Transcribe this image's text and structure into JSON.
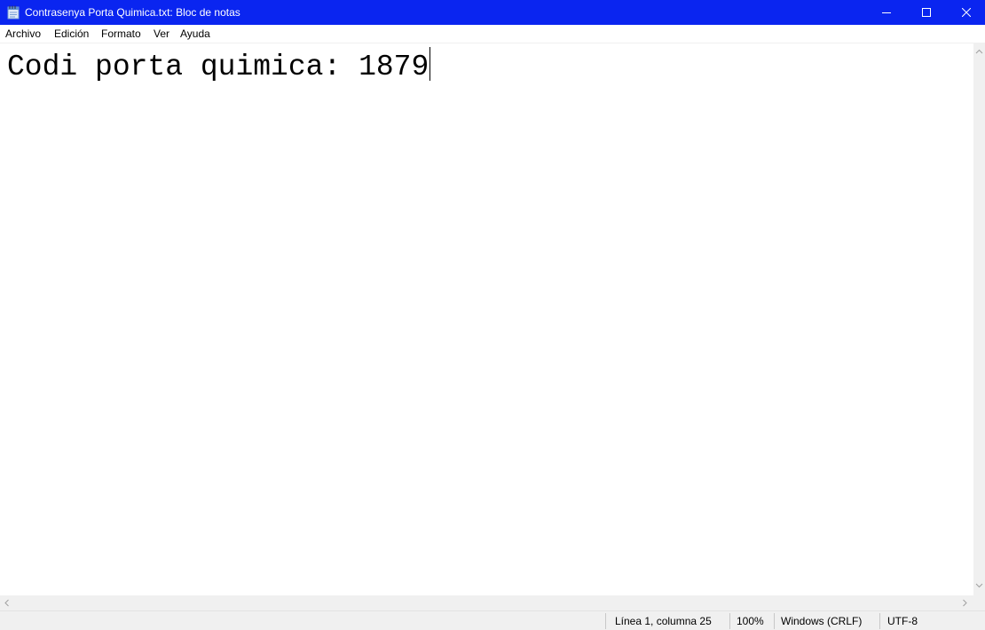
{
  "window": {
    "title": "Contrasenya Porta Quimica.txt: Bloc de notas",
    "titlebar_color": "#0a25f0",
    "icons": {
      "app": "notepad-icon",
      "minimize": "minimize-icon",
      "maximize": "maximize-icon",
      "close": "close-icon"
    }
  },
  "menu": {
    "items": [
      {
        "label": "Archivo"
      },
      {
        "label": "Edición"
      },
      {
        "label": "Formato"
      },
      {
        "label": "Ver"
      },
      {
        "label": "Ayuda"
      }
    ]
  },
  "editor": {
    "content": "Codi porta quimica: 1879"
  },
  "status": {
    "position": "Línea 1, columna 25",
    "zoom": "100%",
    "line_ending": "Windows (CRLF)",
    "encoding": "UTF-8"
  }
}
